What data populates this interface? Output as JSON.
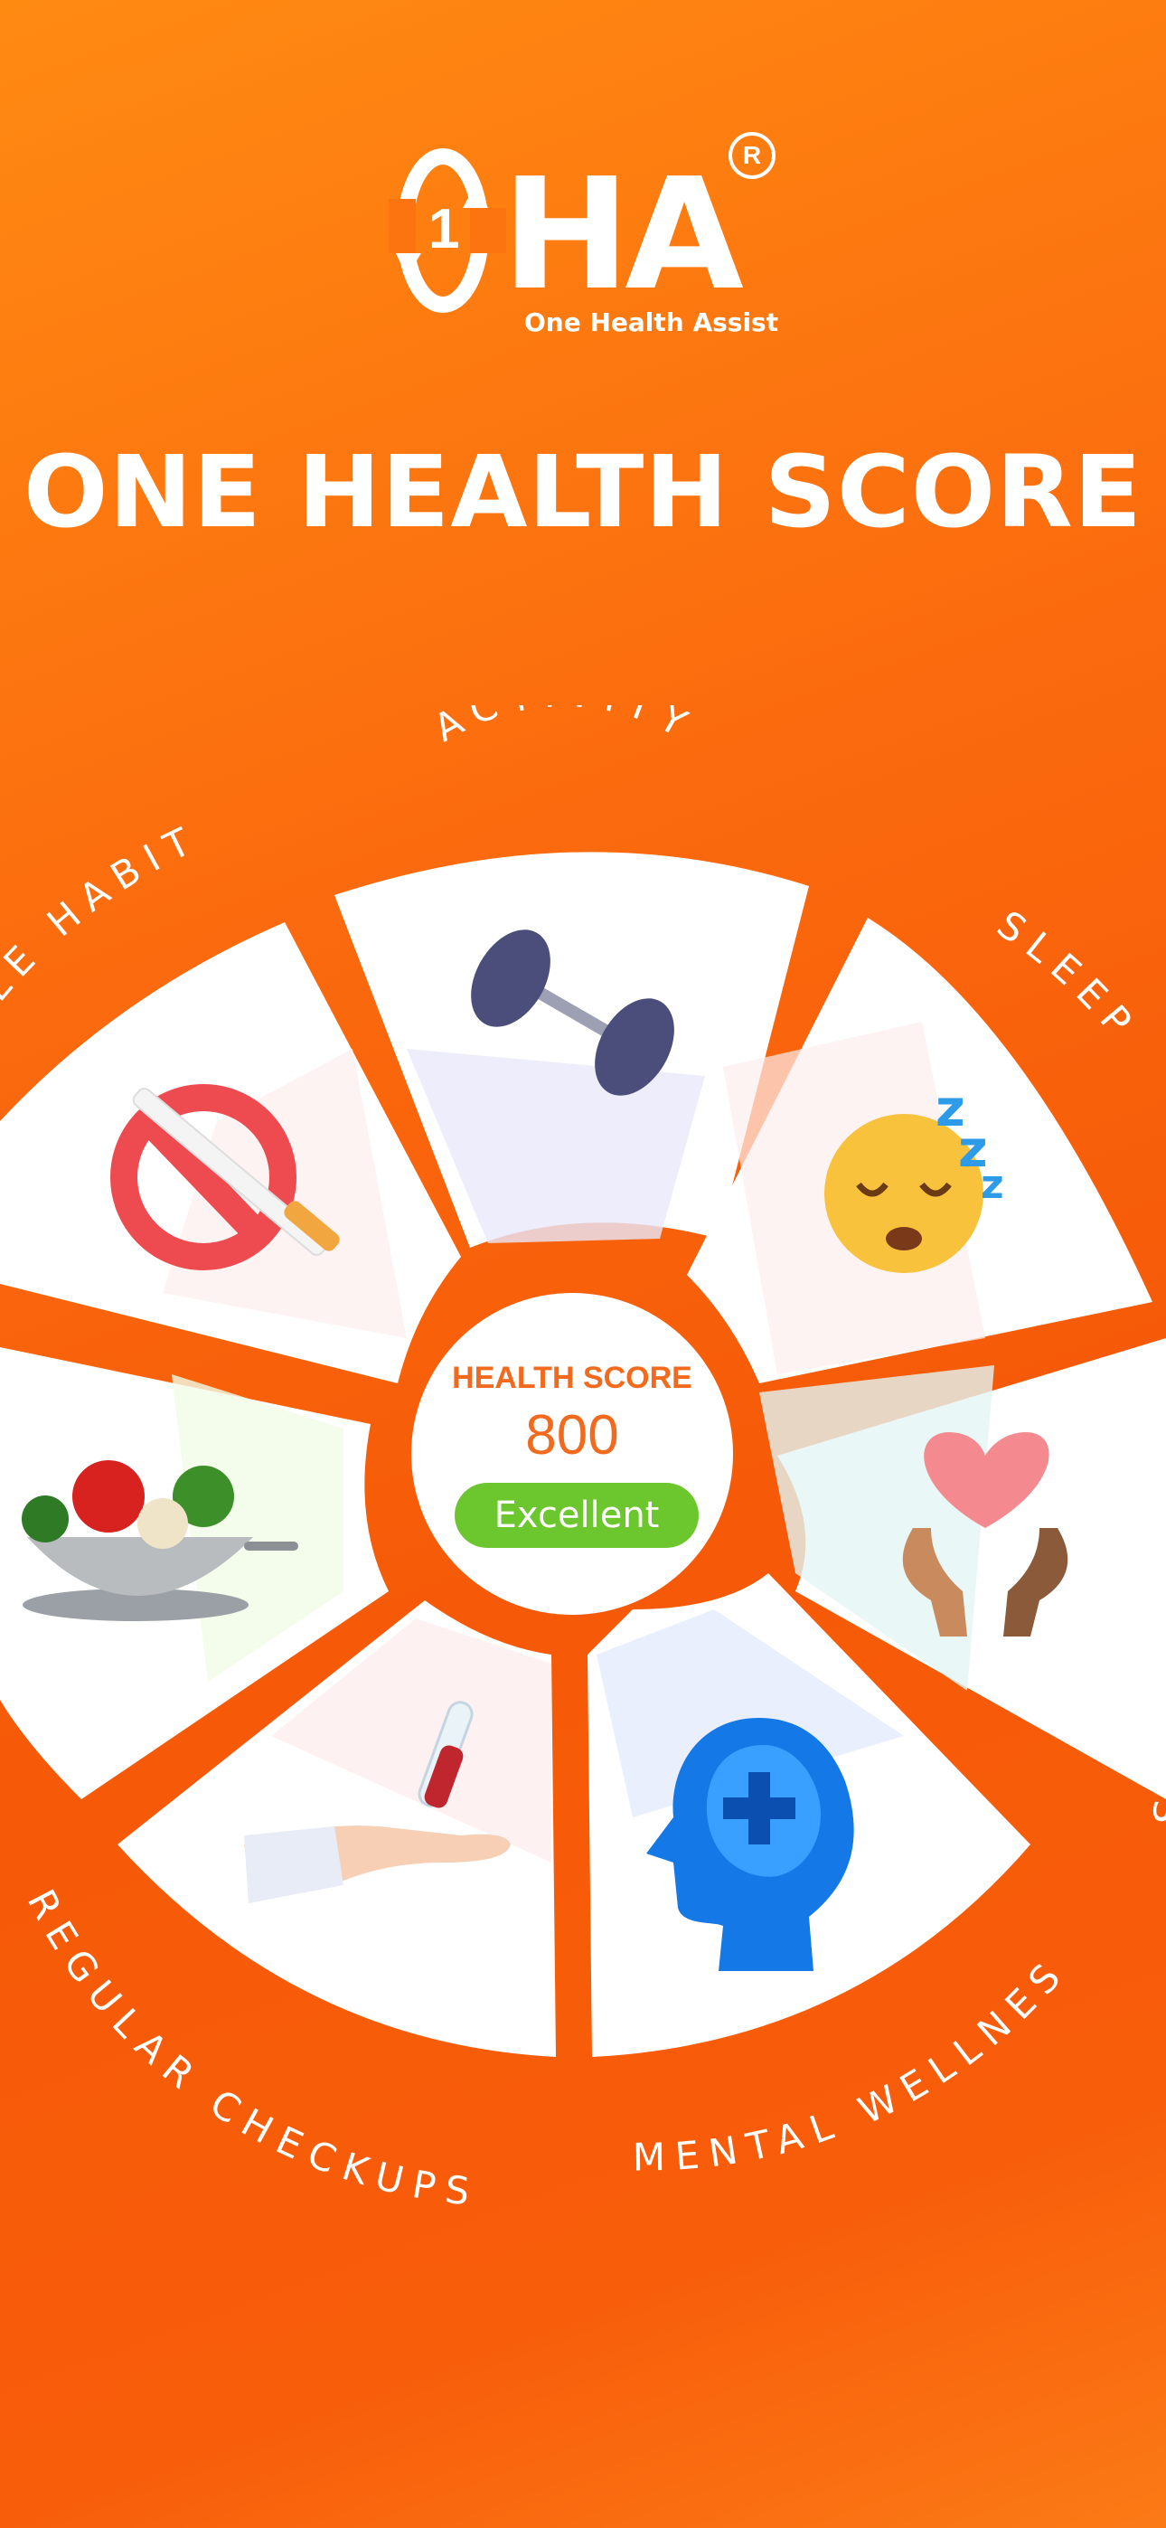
{
  "brand": {
    "logo_letters": "HA",
    "logo_digit": "1",
    "tagline": "One Health Assist",
    "registered_mark": "R"
  },
  "page_title": "ONE HEALTH SCORE",
  "score": {
    "label": "HEALTH SCORE",
    "value": "800",
    "rating": "Excellent",
    "rating_color": "#6cc72e",
    "accent_color": "#f26a1e"
  },
  "segments": [
    {
      "label": "ACTIVITY",
      "icon": "dumbbell-icon"
    },
    {
      "label": "SLEEP",
      "icon": "sleeping-face-icon"
    },
    {
      "label": "S",
      "icon": "heart-hands-icon"
    },
    {
      "label": "MENTAL WELLNES",
      "icon": "mental-health-head-icon"
    },
    {
      "label": "REGULAR CHECKUPS",
      "icon": "blood-test-hand-icon"
    },
    {
      "label": "",
      "icon": "vegetable-bowl-icon"
    },
    {
      "label": "LE HABITS",
      "icon": "no-smoking-icon"
    }
  ]
}
